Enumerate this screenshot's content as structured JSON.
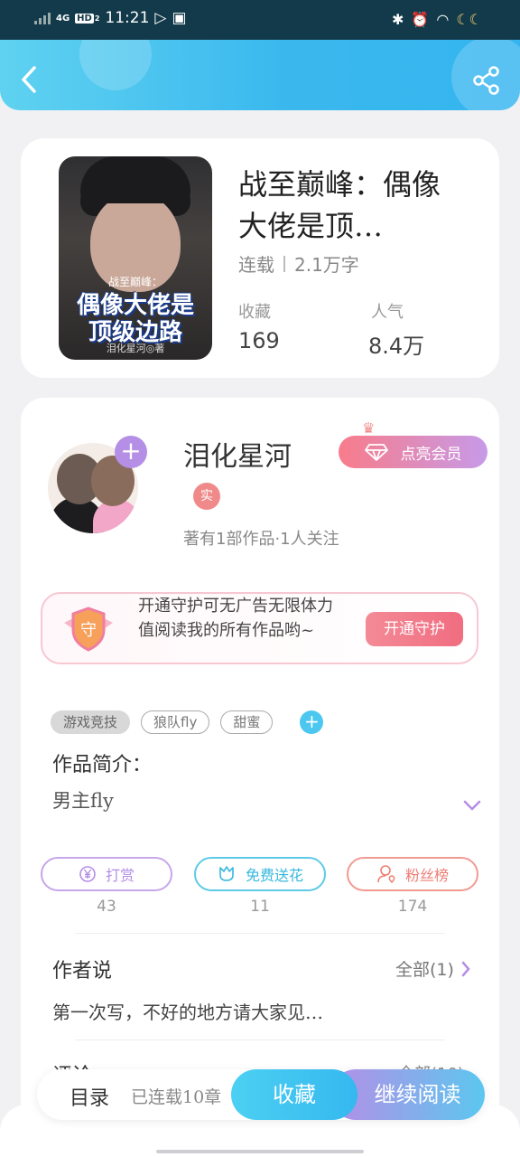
{
  "status_bar": {
    "network": "4G",
    "hd": "HD",
    "hd_sub": "2",
    "time": "11:21"
  },
  "book": {
    "title": "战至巅峰：偶像大佬是顶…",
    "status": "连载",
    "words": "2.1万字",
    "collect_label": "收藏",
    "collect_value": "169",
    "popularity_label": "人气",
    "popularity_value": "8.4万",
    "cover": {
      "small_title": "战至巅峰：",
      "big_title_line1": "偶像大佬是",
      "big_title_line2": "顶级边路",
      "author": "泪化星河◎著"
    }
  },
  "author": {
    "name": "泪化星河",
    "badge": "实",
    "stats": "著有1部作品·1人关注",
    "vip_label": "点亮会员"
  },
  "guard": {
    "shield_text": "守",
    "text": "开通守护可无广告无限体力值阅读我的所有作品哟~",
    "button": "开通守护"
  },
  "tags": [
    "游戏竞技",
    "狼队fly",
    "甜蜜"
  ],
  "intro": {
    "label": "作品简介：",
    "text": "男主fly"
  },
  "actions": [
    {
      "label": "打赏",
      "count": "43",
      "color": "#c7a6ea"
    },
    {
      "label": "免费送花",
      "count": "11",
      "color": "#5ecbe6"
    },
    {
      "label": "粉丝榜",
      "count": "174",
      "color": "#f29a92"
    }
  ],
  "author_says": {
    "title": "作者说",
    "all": "全部(1)",
    "text": "第一次写，不好的地方请大家见…"
  },
  "comments": {
    "title": "评论",
    "all": "全部(10)"
  },
  "bottom": {
    "catalog": "目录",
    "serial": "已连载10章",
    "collect": "收藏",
    "read": "继续阅读"
  },
  "colors": {
    "header": "#3ab8ee",
    "accent_purple": "#b58ee6",
    "accent_pink": "#f48a97"
  }
}
